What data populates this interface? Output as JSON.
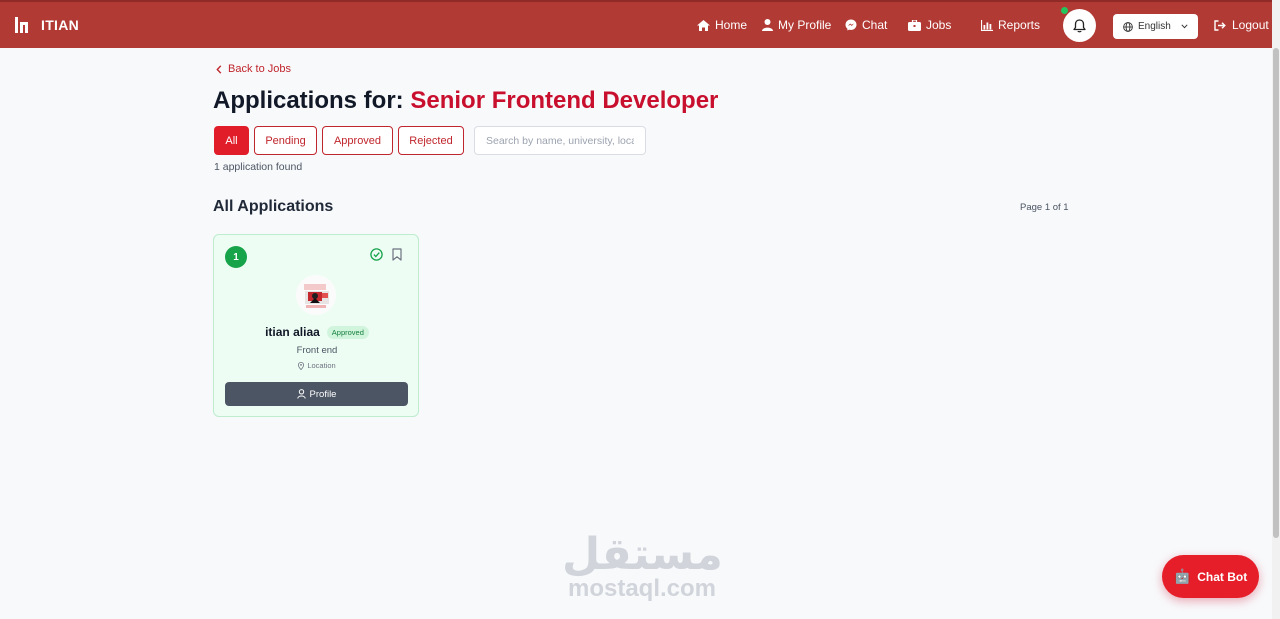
{
  "nav": {
    "brand": "ITIAN",
    "links": [
      {
        "label": "Home",
        "icon": "home-icon"
      },
      {
        "label": "My Profile",
        "icon": "user-icon"
      },
      {
        "label": "Chat",
        "icon": "messenger-icon"
      },
      {
        "label": "Jobs",
        "icon": "briefcase-icon"
      },
      {
        "label": "Reports",
        "icon": "chart-icon"
      }
    ],
    "language": "English",
    "logout": "Logout"
  },
  "page": {
    "back_label": "Back to Jobs",
    "title_prefix": "Applications for:",
    "job_title": "Senior Frontend Developer",
    "filters": [
      "All",
      "Pending",
      "Approved",
      "Rejected"
    ],
    "active_filter": "All",
    "search_placeholder": "Search by name, university, location",
    "count_text": "1 application found",
    "section_title": "All Applications",
    "page_info": "Page 1 of 1"
  },
  "applications": [
    {
      "number": "1",
      "name": "itian aliaa",
      "status": "Approved",
      "role": "Front end",
      "location": "Location",
      "profile_label": "Profile"
    }
  ],
  "watermark": {
    "arabic": "مستقل",
    "latin": "mostaql.com"
  },
  "chatbot": {
    "label": "Chat Bot"
  },
  "colors": {
    "navbar": "#b23a35",
    "accent": "#e11d2a",
    "approved": "#16a34a",
    "card_bg": "#eefdf3"
  }
}
